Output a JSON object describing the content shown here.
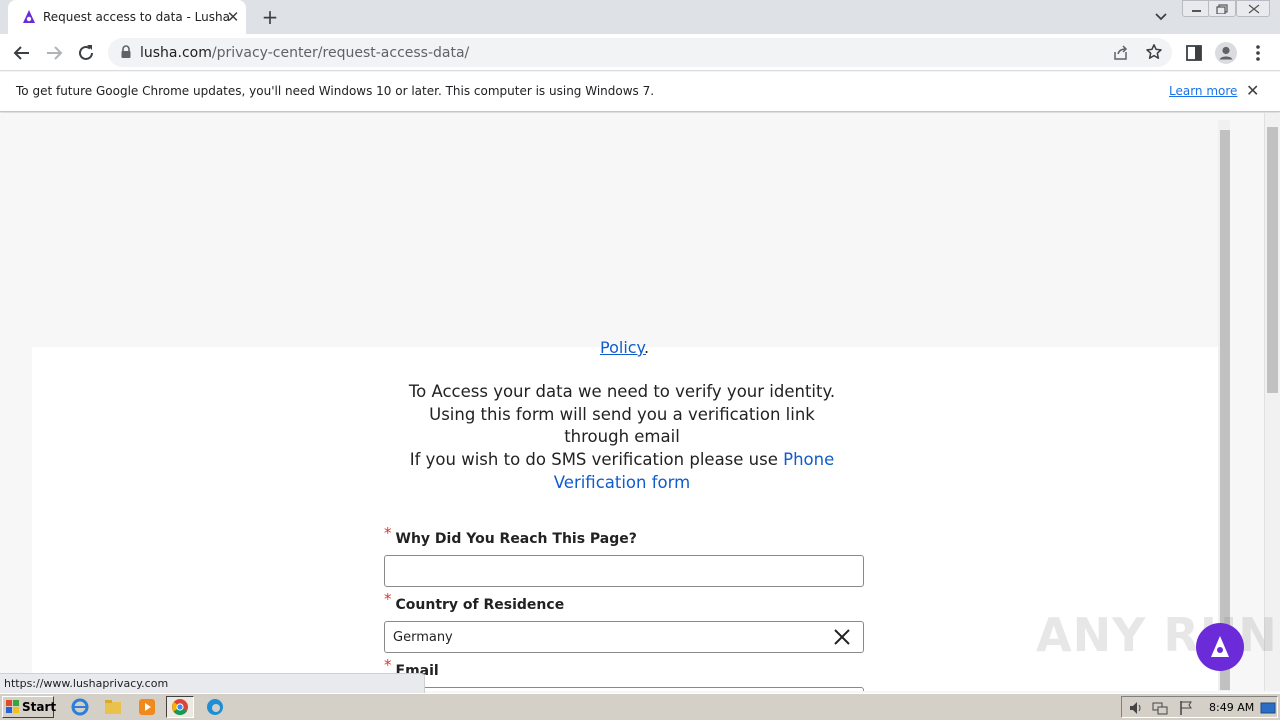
{
  "browser": {
    "tab_title": "Request access to data - Lusha",
    "url_host": "lusha.com",
    "url_path": "/privacy-center/request-access-data/",
    "infobar_message": "To get future Google Chrome updates, you'll need Windows 10 or later. This computer is using Windows 7.",
    "infobar_link": "Learn more",
    "status_url": "https://www.lushaprivacy.com"
  },
  "page": {
    "policy_link": "Policy",
    "policy_period": ".",
    "intro_line1": "To Access your data we need to verify your identity.",
    "intro_line2": "Using this form will send you a verification link through email",
    "intro_line3": "If you wish to do SMS verification please use",
    "phone_link": "Phone Verification form",
    "form": {
      "required_mark": "*",
      "reason_label": "Why Did You Reach This Page?",
      "reason_value": "",
      "country_label": "Country of Residence",
      "country_value": "Germany",
      "email_label": "Email"
    }
  },
  "watermark": "ANY RUN",
  "taskbar": {
    "start_label": "Start",
    "clock": "8:49 AM"
  },
  "colors": {
    "brand_purple": "#6b2bd9",
    "link_blue": "#0f5ccc",
    "required_red": "#d43a2f"
  }
}
